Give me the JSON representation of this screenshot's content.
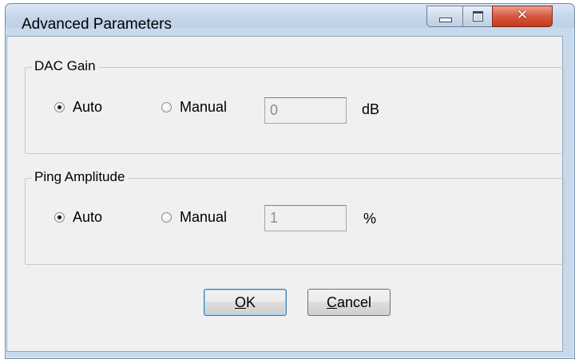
{
  "window": {
    "title": "Advanced Parameters",
    "controls": {
      "minimize": "minimize-icon",
      "maximize": "maximize-icon",
      "close": "close-icon"
    }
  },
  "dac_gain": {
    "group_label": "DAC Gain",
    "auto_label": "Auto",
    "manual_label": "Manual",
    "selected": "Auto",
    "value": "0",
    "unit": "dB"
  },
  "ping_amplitude": {
    "group_label": "Ping Amplitude",
    "auto_label": "Auto",
    "manual_label": "Manual",
    "selected": "Auto",
    "value": "1",
    "unit": "%"
  },
  "buttons": {
    "ok_accel": "O",
    "ok_rest": "K",
    "cancel_accel": "C",
    "cancel_rest": "ancel"
  }
}
